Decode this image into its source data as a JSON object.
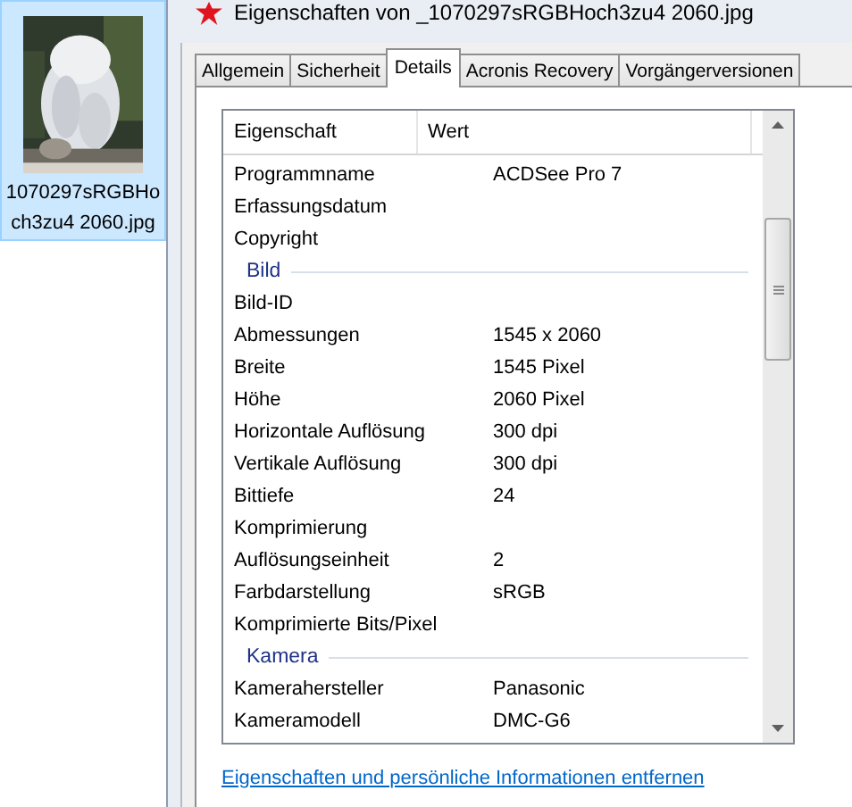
{
  "file_item": {
    "lines": [
      "1070297sRGBHo",
      "ch3zu4 2060.jpg"
    ],
    "selected": true
  },
  "window": {
    "title": "Eigenschaften von _1070297sRGBHoch3zu4 2060.jpg"
  },
  "tabs": [
    {
      "label": "Allgemein",
      "selected": false
    },
    {
      "label": "Sicherheit",
      "selected": false
    },
    {
      "label": "Details",
      "selected": true
    },
    {
      "label": "Acronis Recovery",
      "selected": false
    },
    {
      "label": "Vorgängerversionen",
      "selected": false
    }
  ],
  "table": {
    "columns": [
      "Eigenschaft",
      "Wert"
    ],
    "rows": [
      {
        "kind": "row",
        "name": "Programmname",
        "value": "ACDSee Pro 7"
      },
      {
        "kind": "row",
        "name": "Erfassungsdatum"
      },
      {
        "kind": "row",
        "name": "Copyright"
      },
      {
        "kind": "group",
        "name": "Bild"
      },
      {
        "kind": "row",
        "name": "Bild-ID"
      },
      {
        "kind": "row",
        "name": "Abmessungen",
        "value": "1545 x 2060"
      },
      {
        "kind": "row",
        "name": "Breite",
        "value": "1545 Pixel"
      },
      {
        "kind": "row",
        "name": "Höhe",
        "value": "2060 Pixel"
      },
      {
        "kind": "row",
        "name": "Horizontale Auflösung",
        "value": "300 dpi"
      },
      {
        "kind": "row",
        "name": "Vertikale Auflösung",
        "value": "300 dpi"
      },
      {
        "kind": "row",
        "name": "Bittiefe",
        "value": "24"
      },
      {
        "kind": "row",
        "name": "Komprimierung"
      },
      {
        "kind": "row",
        "name": "Auflösungseinheit",
        "value": "2"
      },
      {
        "kind": "row",
        "name": "Farbdarstellung",
        "value": "sRGB"
      },
      {
        "kind": "row",
        "name": "Komprimierte Bits/Pixel"
      },
      {
        "kind": "group",
        "name": "Kamera"
      },
      {
        "kind": "row",
        "name": "Kamerahersteller",
        "value": "Panasonic"
      },
      {
        "kind": "row",
        "name": "Kameramodell",
        "value": "DMC-G6"
      }
    ]
  },
  "link": "Eigenschaften und persönliche Informationen entfernen"
}
